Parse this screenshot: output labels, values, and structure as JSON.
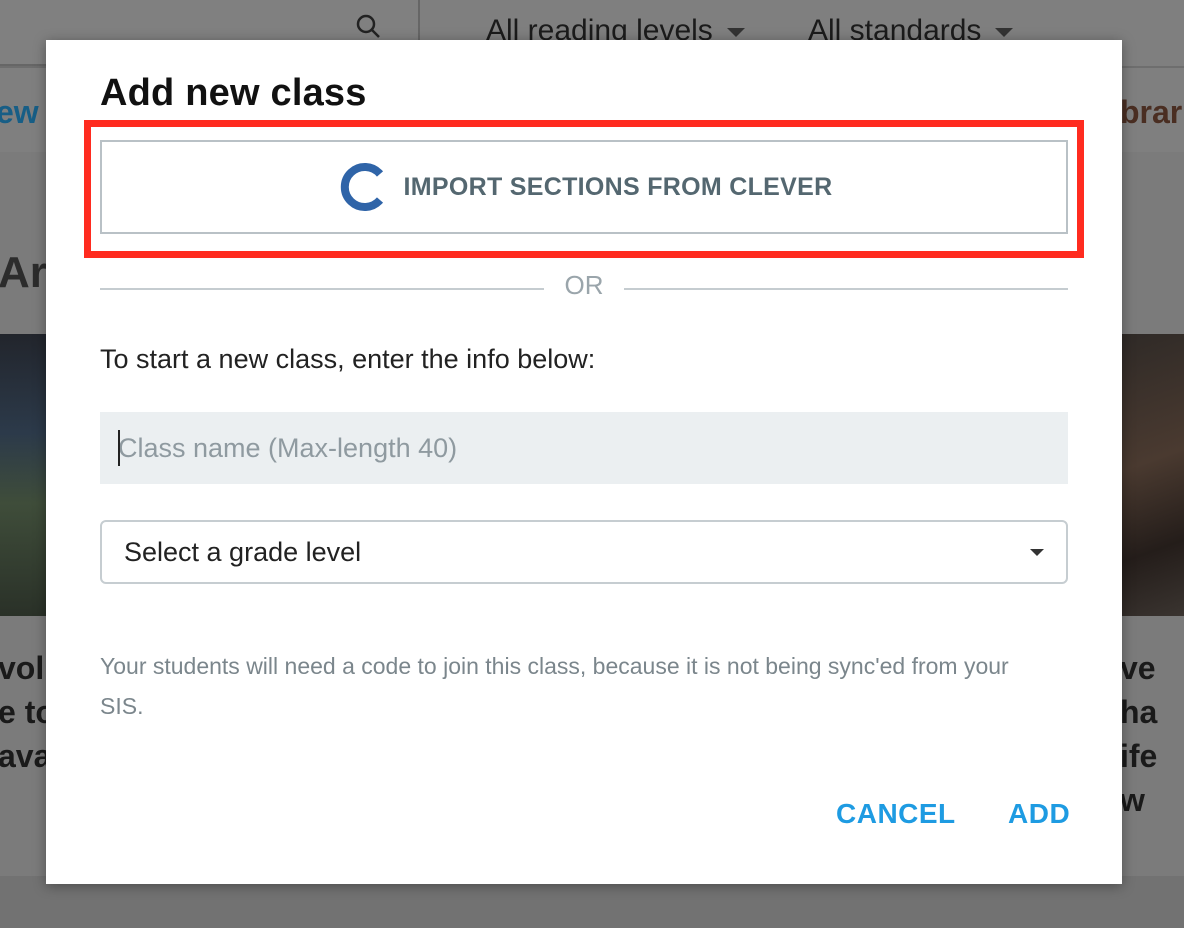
{
  "background": {
    "filters": [
      "All reading levels",
      "All standards"
    ],
    "nav_left_fragment": "ew",
    "nav_right_fragment": "brar",
    "heading_fragment": "Ar",
    "card_left_lines": [
      "vol",
      "e to",
      "ava"
    ],
    "card_right_lines": [
      "ve ha",
      "ife w"
    ]
  },
  "modal": {
    "title": "Add new class",
    "import_button_label": "IMPORT SECTIONS FROM CLEVER",
    "import_icon": "clever-logo-icon",
    "or_label": "OR",
    "instruction": "To start a new class, enter the info below:",
    "class_name": {
      "value": "",
      "placeholder": "Class name (Max-length 40)"
    },
    "grade_select": {
      "selected": "Select a grade level"
    },
    "note": "Your students will need a code to join this class, because it is not being sync'ed from your SIS.",
    "cancel_label": "CANCEL",
    "add_label": "ADD"
  },
  "colors": {
    "accent": "#1e9be2",
    "highlight": "#ff2b1f",
    "clever_blue": "#2f64a8"
  }
}
